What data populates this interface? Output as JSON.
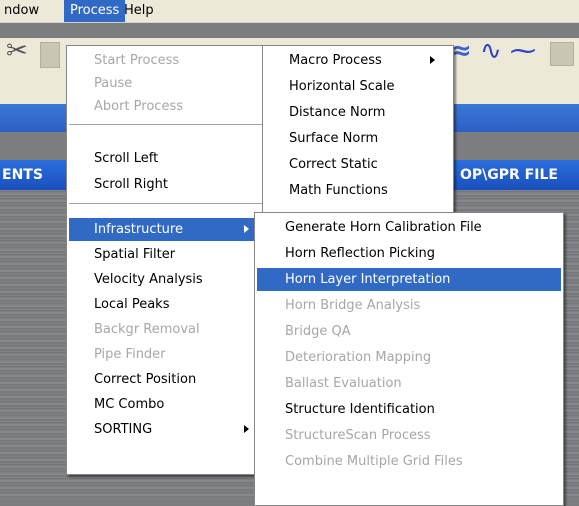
{
  "menubar": {
    "items": [
      {
        "label": "ndow"
      },
      {
        "label": "Process"
      },
      {
        "label": "Help"
      }
    ]
  },
  "header": {
    "left_text": "ENTS",
    "right_text": "OP\\GPR FILE"
  },
  "process_menu": {
    "group1": [
      "Start Process",
      "Pause",
      "Abort Process"
    ],
    "group2": [
      "Scroll Left",
      "Scroll Right"
    ],
    "group3": [
      "Infrastructure",
      "Spatial Filter",
      "Velocity Analysis",
      "Local Peaks",
      "Backgr Removal",
      "Pipe Finder",
      "Correct Position",
      "MC Combo",
      "SORTING"
    ]
  },
  "top_submenu": {
    "items": [
      "Macro Process",
      "Horizontal Scale",
      "Distance Norm",
      "Surface Norm",
      "Correct Static",
      "Math Functions"
    ]
  },
  "infra_submenu": {
    "items": [
      "Generate Horn Calibration File",
      "Horn Reflection Picking",
      "Horn Layer Interpretation",
      "Horn Bridge Analysis",
      "Bridge QA",
      "Deterioration Mapping",
      "Ballast Evaluation",
      "Structure Identification",
      "StructureScan Process",
      "Combine Multiple Grid Files"
    ]
  },
  "icons": {
    "scissors": "scissors-icon",
    "wave": "wave-icon",
    "squiggle": "squiggle-icon"
  },
  "colors": {
    "highlight": "#316ac5",
    "disabled": "#a7a6aa",
    "menu_bg": "#ffffff",
    "titlebar": "#2d5fc4"
  }
}
